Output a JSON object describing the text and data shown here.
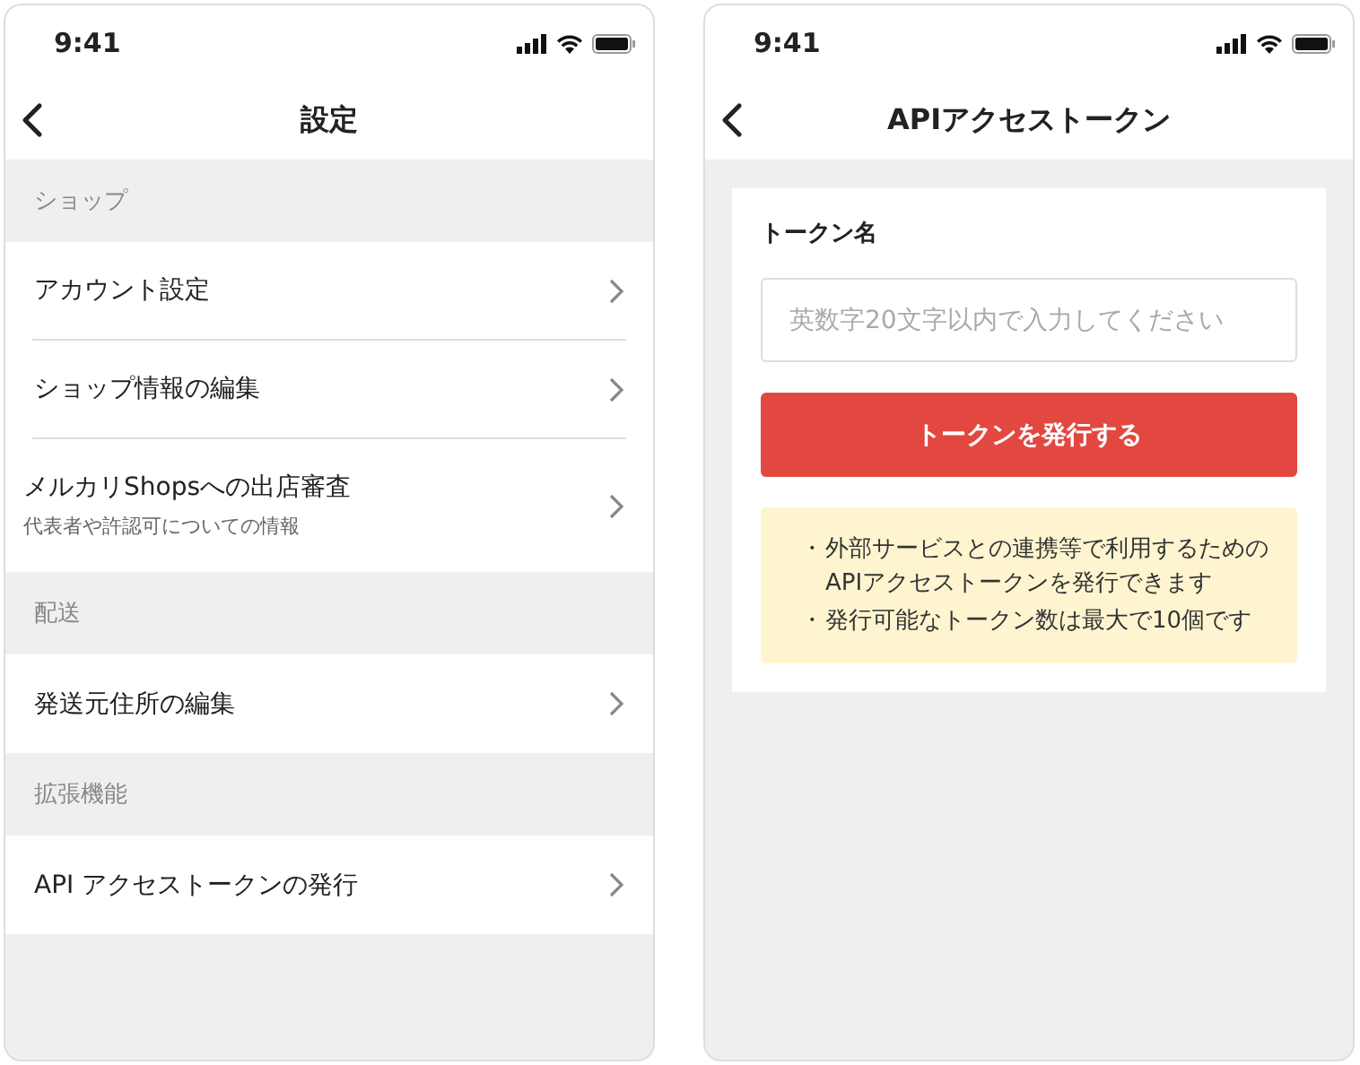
{
  "screens": [
    {
      "kind": "settings",
      "status_time": "9:41",
      "title": "設定",
      "sections": [
        {
          "header": "ショップ",
          "items": [
            {
              "label": "アカウント設定"
            },
            {
              "label": "ショップ情報の編集"
            },
            {
              "label": "メルカリShopsへの出店審査",
              "sublabel": "代表者や許認可についての情報"
            }
          ]
        },
        {
          "header": "配送",
          "items": [
            {
              "label": "発送元住所の編集"
            }
          ]
        },
        {
          "header": "拡張機能",
          "items": [
            {
              "label": "API アクセストークンの発行"
            }
          ]
        }
      ]
    },
    {
      "kind": "token",
      "status_time": "9:41",
      "title": "APIアクセストークン",
      "field_label": "トークン名",
      "input": {
        "placeholder": "英数字20文字以内で入力してください"
      },
      "button": "トークンを発行する",
      "notes": [
        {
          "bullet": "・",
          "text": "外部サービスとの連携等で利用するためのAPIアクセストークンを発行できます"
        },
        {
          "bullet": "・",
          "text": "発行可能なトークン数は最大で10個です"
        }
      ]
    }
  ]
}
